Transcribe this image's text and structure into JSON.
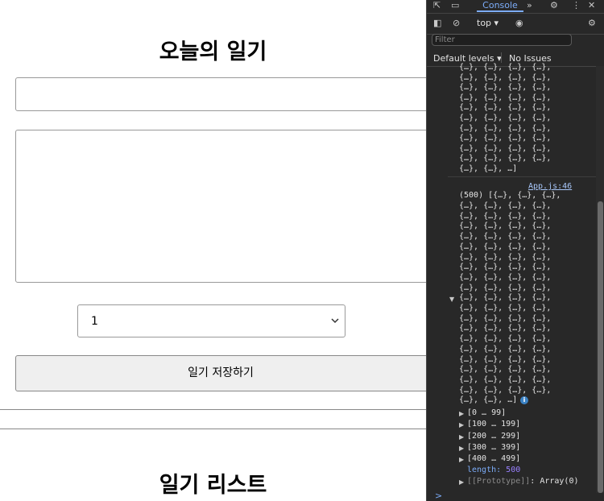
{
  "app": {
    "title": "오늘의 일기",
    "emotion_selected": "1",
    "save_label": "일기 저장하기",
    "list_title": "일기 리스트"
  },
  "devtools": {
    "tab_console": "Console",
    "context": "top",
    "filter_placeholder": "Filter",
    "levels": "Default levels",
    "issues": "No Issues",
    "source_link": "App.js:46",
    "array_header": "(500) [{…}, {…}, {…},",
    "row_text": "{…}, {…}, {…}, {…},",
    "last_row_top": "{…}, {…}, …]",
    "last_row_bottom": "{…}, {…}, …]",
    "ranges": [
      "[0 … 99]",
      "[100 … 199]",
      "[200 … 299]",
      "[300 … 399]",
      "[400 … 499]"
    ],
    "length_key": "length",
    "length_value": "500",
    "prototype_key": "[[Prototype]]",
    "prototype_value": "Array(0)",
    "prompt": ">"
  }
}
